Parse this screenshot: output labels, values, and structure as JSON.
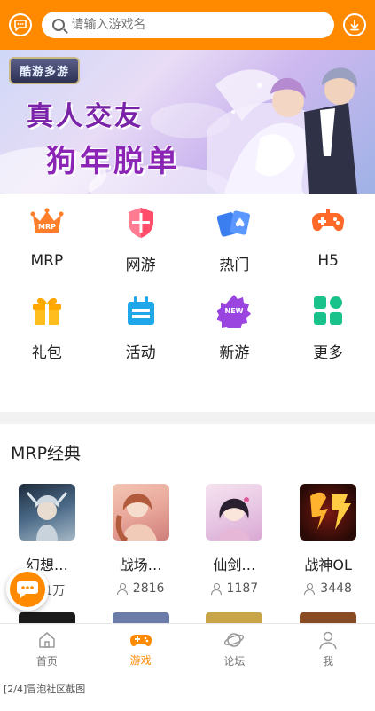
{
  "header": {
    "search_placeholder": "请输入游戏名",
    "chat_icon": "chat-bubble-icon",
    "download_icon": "download-icon",
    "accent_color": "#ff8a00"
  },
  "banner": {
    "logo_text": "酷游多游",
    "line1": "真人交友",
    "line2": "狗年脱单"
  },
  "categories": [
    {
      "label": "MRP",
      "icon": "crown-mrp-icon"
    },
    {
      "label": "网游",
      "icon": "shield-icon"
    },
    {
      "label": "热门",
      "icon": "cards-icon"
    },
    {
      "label": "H5",
      "icon": "gamepad-icon"
    },
    {
      "label": "礼包",
      "icon": "gift-icon"
    },
    {
      "label": "活动",
      "icon": "calendar-icon"
    },
    {
      "label": "新游",
      "icon": "new-badge-icon"
    },
    {
      "label": "更多",
      "icon": "more-grid-icon"
    }
  ],
  "new_badge": "NEW",
  "mrp_badge": "MRP",
  "section": {
    "title": "MRP经典"
  },
  "games": [
    {
      "name": "幻想…",
      "count": "1万"
    },
    {
      "name": "战场…",
      "count": "2816"
    },
    {
      "name": "仙剑…",
      "count": "1187"
    },
    {
      "name": "战神OL",
      "count": "3448"
    }
  ],
  "tabs": [
    {
      "label": "首页",
      "icon": "home-icon",
      "active": false
    },
    {
      "label": "游戏",
      "icon": "game-controller-icon",
      "active": true
    },
    {
      "label": "论坛",
      "icon": "planet-icon",
      "active": false
    },
    {
      "label": "我",
      "icon": "user-icon",
      "active": false
    }
  ],
  "caption": "[2/4]冒泡社区截图"
}
